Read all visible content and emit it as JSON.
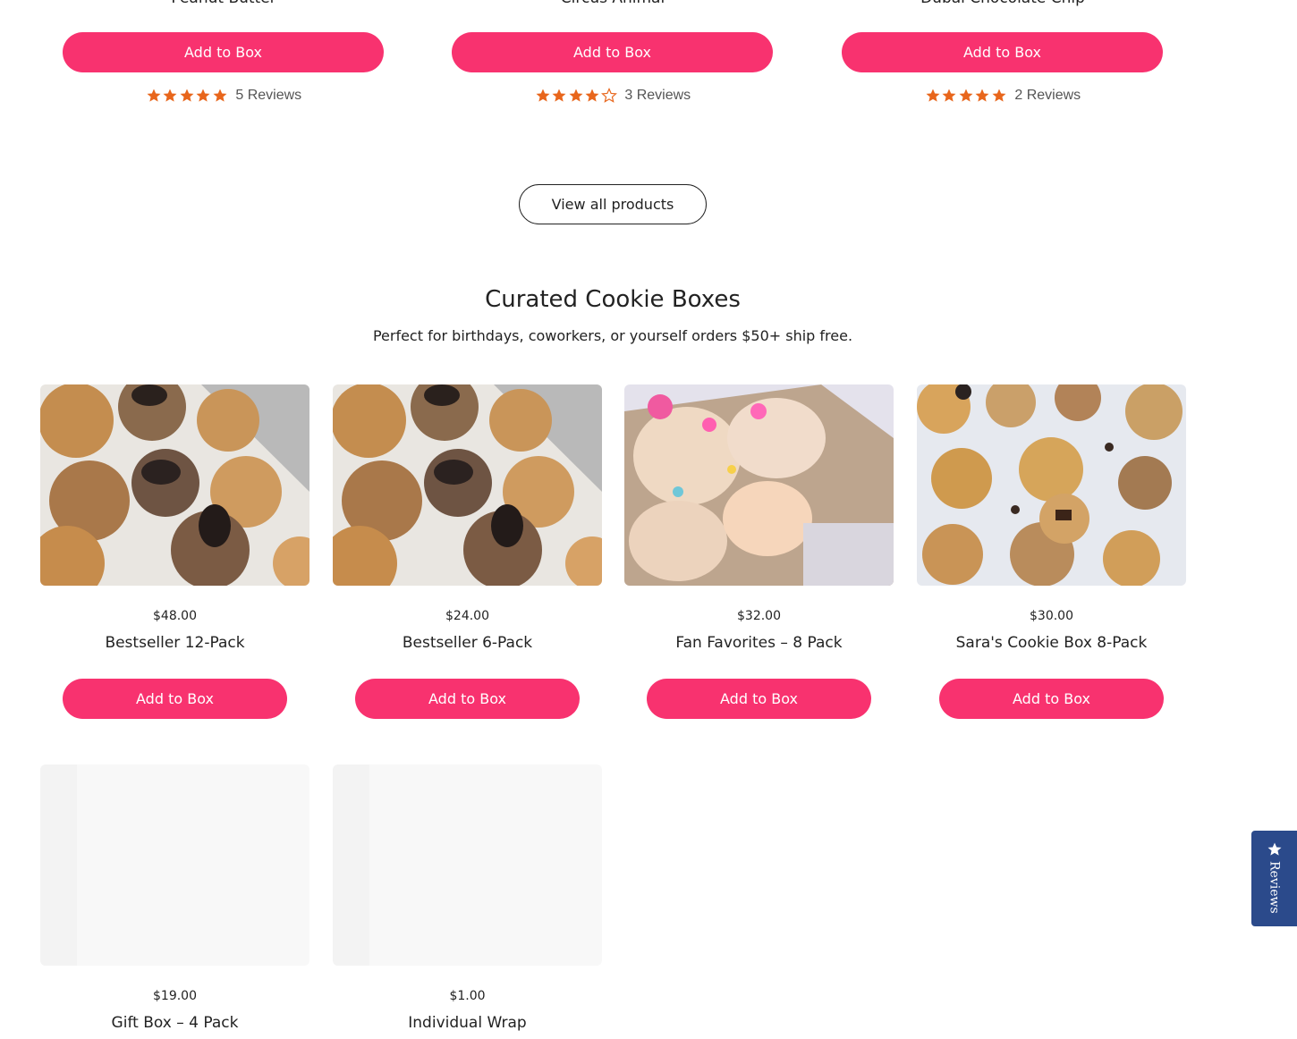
{
  "top_products": [
    {
      "name": "Peanut Butter",
      "button_label": "Add to Box",
      "rating": 5,
      "reviews_label": "5 Reviews"
    },
    {
      "name": "Circus Animal",
      "button_label": "Add to Box",
      "rating": 4,
      "reviews_label": "3 Reviews"
    },
    {
      "name": "Dubai Chocolate Chip",
      "button_label": "Add to Box",
      "rating": 5,
      "reviews_label": "2 Reviews"
    }
  ],
  "view_all_label": "View all products",
  "curated": {
    "title": "Curated Cookie Boxes",
    "subtitle": "Perfect for birthdays, coworkers, or yourself orders $50+ ship free.",
    "boxes": [
      {
        "price": "$48.00",
        "name": "Bestseller 12-Pack",
        "button_label": "Add to Box"
      },
      {
        "price": "$24.00",
        "name": "Bestseller 6-Pack",
        "button_label": "Add to Box"
      },
      {
        "price": "$32.00",
        "name": "Fan Favorites – 8 Pack",
        "button_label": "Add to Box"
      },
      {
        "price": "$30.00",
        "name": "Sara's Cookie Box 8-Pack",
        "button_label": "Add to Box"
      },
      {
        "price": "$19.00",
        "name": "Gift Box – 4 Pack"
      },
      {
        "price": "$1.00",
        "name": "Individual Wrap"
      }
    ]
  },
  "reviews_tab": {
    "label": "Reviews",
    "icon": "star-icon"
  },
  "colors": {
    "accent": "#f8326f",
    "star": "#e8661c",
    "reviews_tab": "#2b4a8b"
  }
}
